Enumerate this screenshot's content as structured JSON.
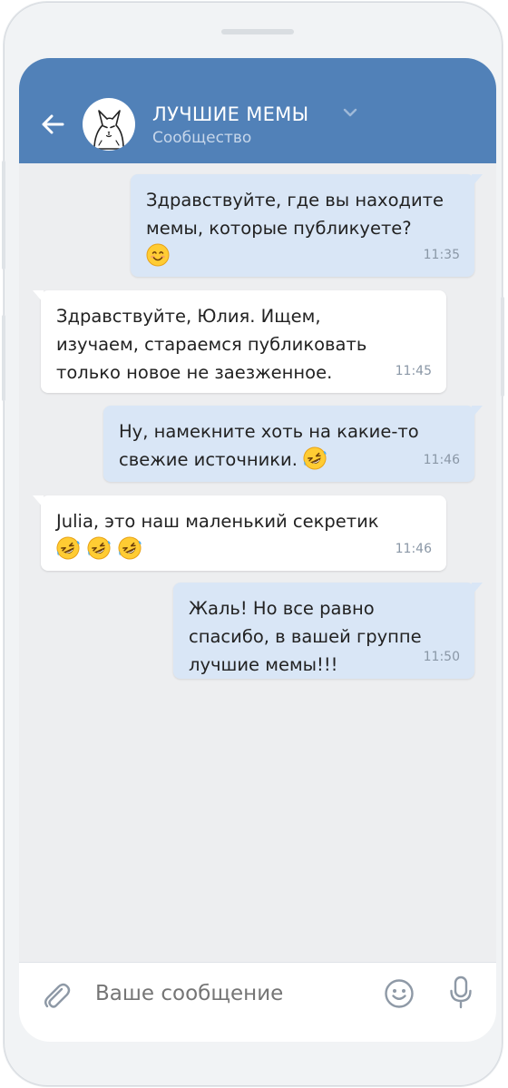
{
  "header": {
    "title": "ЛУЧШИЕ МЕМЫ",
    "subtitle": "Сообщество"
  },
  "messages": [
    {
      "direction": "out",
      "lines": [
        "Здравствуйте, где вы находите",
        "мемы, которые публикуете?"
      ],
      "emoji": [
        "smiling-face"
      ],
      "time": "11:35"
    },
    {
      "direction": "in",
      "lines": [
        "Здравствуйте, Юлия. Ищем,",
        "изучаем, стараемся публиковать",
        "только новое не заезженное."
      ],
      "emoji": [],
      "time": "11:45"
    },
    {
      "direction": "out",
      "lines": [
        "Ну, намекните хоть на какие-то",
        "свежие источники."
      ],
      "emoji": [
        "rofl-face"
      ],
      "time": "11:46"
    },
    {
      "direction": "in",
      "lines": [
        "Julia, это наш маленький секретик"
      ],
      "emoji": [
        "rofl-face",
        "rofl-face",
        "rofl-face"
      ],
      "time": "11:46"
    },
    {
      "direction": "out",
      "lines": [
        "Жаль! Но все равно",
        "спасибо, в вашей группе",
        "лучшие мемы!!!"
      ],
      "emoji": [],
      "time": "11:50"
    }
  ],
  "composer": {
    "placeholder": "Ваше сообщение"
  },
  "colors": {
    "header": "#5181b8",
    "chat_bg": "#edeef0",
    "bubble_out": "#d9e6f6",
    "bubble_in": "#ffffff"
  },
  "icons": [
    "back-arrow-icon",
    "chevron-down-icon",
    "paperclip-icon",
    "smile-icon",
    "microphone-icon"
  ]
}
